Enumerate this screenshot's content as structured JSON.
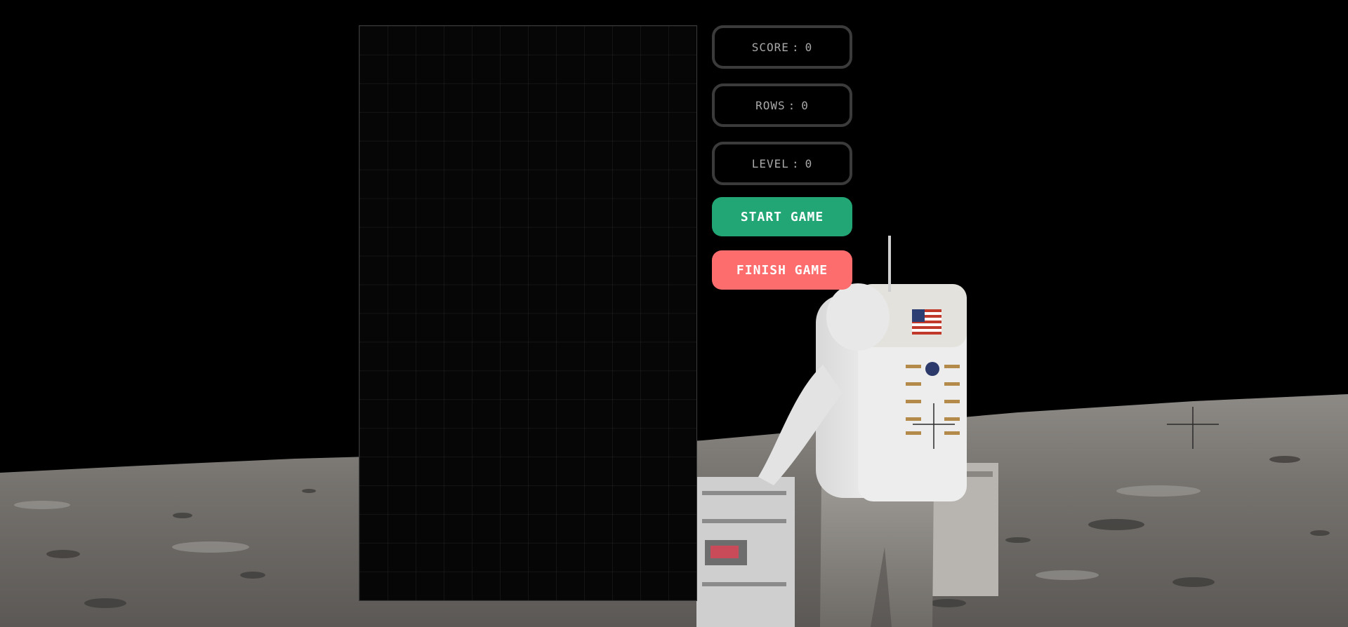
{
  "stats": {
    "score": {
      "label": "SCORE",
      "value": "0"
    },
    "rows": {
      "label": "ROWS",
      "value": "0"
    },
    "level": {
      "label": "LEVEL",
      "value": "0"
    }
  },
  "buttons": {
    "start": "START GAME",
    "finish": "FINISH GAME"
  },
  "board": {
    "columns": 12,
    "rows": 20
  },
  "colors": {
    "start_button": "#22a676",
    "finish_button": "#fe6d6e",
    "stat_border": "#3b3b3b",
    "board_background": "#060606"
  }
}
